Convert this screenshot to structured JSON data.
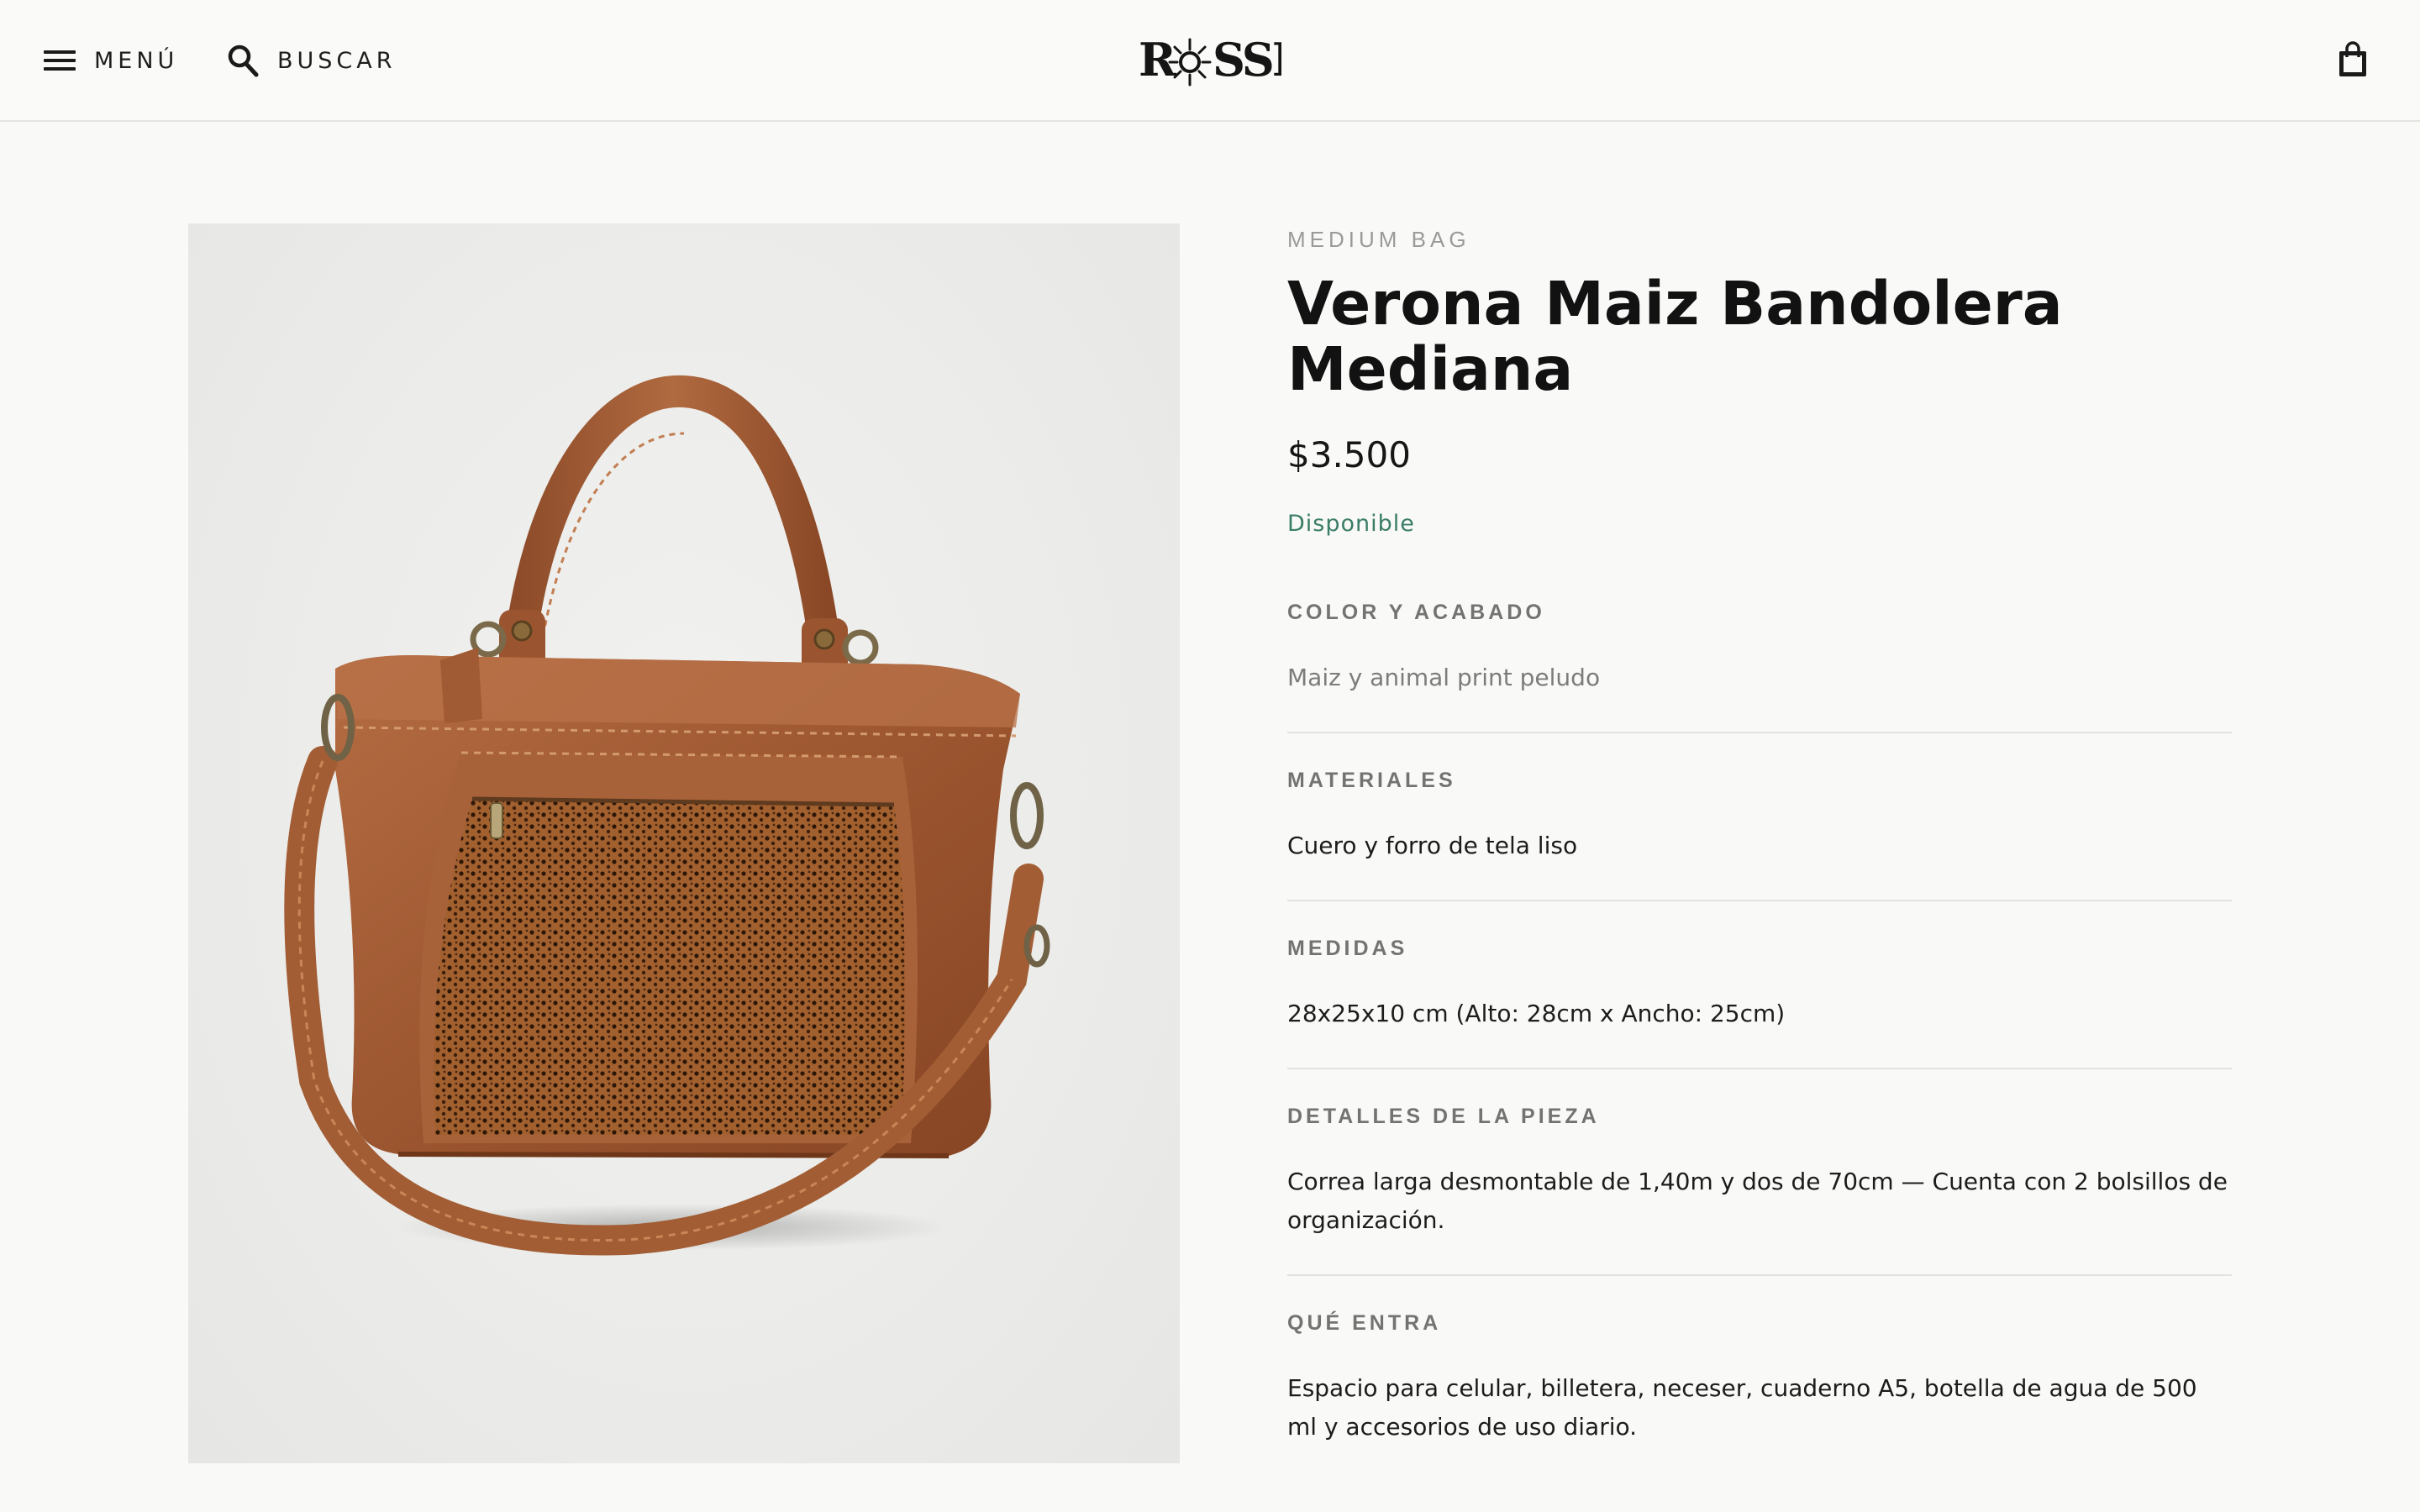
{
  "header": {
    "menu_label": "MENÚ",
    "search_label": "BUSCAR",
    "logo_text": "ROSSI",
    "icons": [
      "hamburger-icon",
      "search-icon",
      "shopping-bag-icon",
      "sun-logo-mark"
    ]
  },
  "product": {
    "category": "MEDIUM BAG",
    "title": "Verona Maiz Bandolera Mediana",
    "price": "$3.500",
    "availability": "Disponible",
    "image_alt": "Cartera de cuero color maíz con bolsillo frontal animal print"
  },
  "specs": [
    {
      "label": "COLOR Y ACABADO",
      "value": "Maiz y animal print peludo"
    },
    {
      "label": "MATERIALES",
      "value": "Cuero y forro de tela liso"
    },
    {
      "label": "MEDIDAS",
      "value": "28x25x10 cm (Alto: 28cm x Ancho: 25cm)"
    },
    {
      "label": "DETALLES DE LA PIEZA",
      "value": "Correa larga desmontable de 1,40m y dos de 70cm — Cuenta con 2 bolsillos de organización."
    },
    {
      "label": "QUÉ ENTRA",
      "value": "Espacio para celular, billetera, neceser, cuaderno A5, botella de agua de 500 ml y accesorios de uso diario."
    }
  ],
  "colors": {
    "background": "#f9f9f7",
    "text": "#141414",
    "available_green": "#3b7d68",
    "label_gray": "#737371",
    "leather": "#a8623a"
  }
}
